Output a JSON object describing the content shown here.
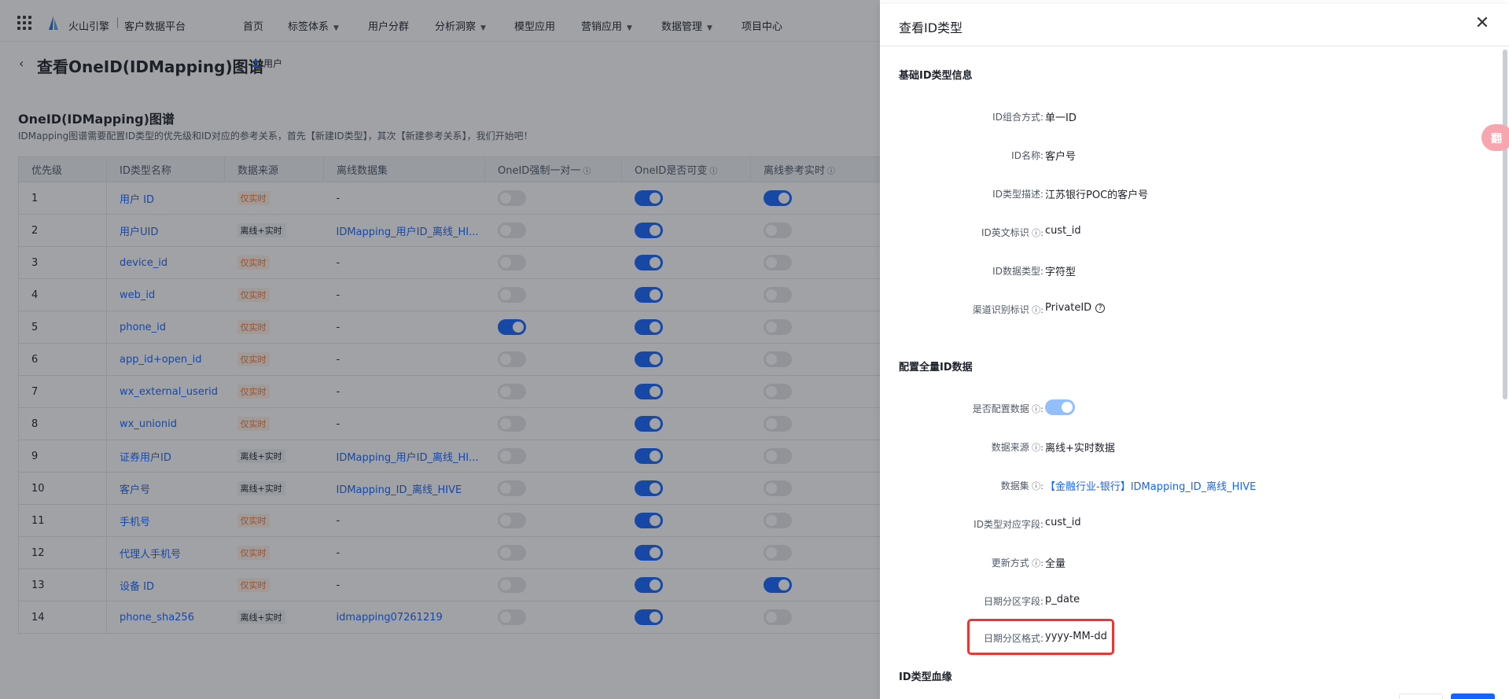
{
  "header": {
    "brand": "火山引擎",
    "platform": "客户数据平台",
    "nav": [
      {
        "label": "首页",
        "has_caret": false
      },
      {
        "label": "标签体系",
        "has_caret": true
      },
      {
        "label": "用户分群",
        "has_caret": false
      },
      {
        "label": "分析洞察",
        "has_caret": true
      },
      {
        "label": "模型应用",
        "has_caret": false
      },
      {
        "label": "营销应用",
        "has_caret": true
      },
      {
        "label": "数据管理",
        "has_caret": true
      },
      {
        "label": "项目中心",
        "has_caret": false
      }
    ]
  },
  "page": {
    "title": "查看OneID(IDMapping)图谱",
    "user_tag": "用户",
    "section_title": "OneID(IDMapping)图谱",
    "section_desc": "IDMapping图谱需要配置ID类型的优先级和ID对应的参考关系，首先【新建ID类型】，其次【新建参考关系】，我们开始吧！"
  },
  "table": {
    "headers": [
      "优先级",
      "ID类型名称",
      "数据来源",
      "离线数据集",
      "OneID强制一对一",
      "OneID是否可变",
      "离线参考实时"
    ],
    "rows": [
      {
        "priority": "1",
        "name": "用户 ID",
        "source": "仅实时",
        "source_type": "rt",
        "dataset": "-",
        "dataset_link": false,
        "forced": false,
        "mutable": true,
        "offline_ref": true
      },
      {
        "priority": "2",
        "name": "用户UID",
        "source": "离线+实时",
        "source_type": "mix",
        "dataset": "IDMapping_用户ID_离线_HI...",
        "dataset_link": true,
        "forced": false,
        "mutable": true,
        "offline_ref": false
      },
      {
        "priority": "3",
        "name": "device_id",
        "source": "仅实时",
        "source_type": "rt",
        "dataset": "-",
        "dataset_link": false,
        "forced": false,
        "mutable": true,
        "offline_ref": false
      },
      {
        "priority": "4",
        "name": "web_id",
        "source": "仅实时",
        "source_type": "rt",
        "dataset": "-",
        "dataset_link": false,
        "forced": false,
        "mutable": true,
        "offline_ref": false
      },
      {
        "priority": "5",
        "name": "phone_id",
        "source": "仅实时",
        "source_type": "rt",
        "dataset": "-",
        "dataset_link": false,
        "forced": true,
        "mutable": true,
        "offline_ref": false
      },
      {
        "priority": "6",
        "name": "app_id+open_id",
        "source": "仅实时",
        "source_type": "rt",
        "dataset": "-",
        "dataset_link": false,
        "forced": false,
        "mutable": true,
        "offline_ref": false
      },
      {
        "priority": "7",
        "name": "wx_external_userid",
        "source": "仅实时",
        "source_type": "rt",
        "dataset": "-",
        "dataset_link": false,
        "forced": false,
        "mutable": true,
        "offline_ref": false
      },
      {
        "priority": "8",
        "name": "wx_unionid",
        "source": "仅实时",
        "source_type": "rt",
        "dataset": "-",
        "dataset_link": false,
        "forced": false,
        "mutable": true,
        "offline_ref": false
      },
      {
        "priority": "9",
        "name": "证券用户ID",
        "source": "离线+实时",
        "source_type": "mix",
        "dataset": "IDMapping_用户ID_离线_HI...",
        "dataset_link": true,
        "forced": false,
        "mutable": true,
        "offline_ref": false
      },
      {
        "priority": "10",
        "name": "客户号",
        "source": "离线+实时",
        "source_type": "mix",
        "dataset": "IDMapping_ID_离线_HIVE",
        "dataset_link": true,
        "forced": false,
        "mutable": true,
        "offline_ref": false
      },
      {
        "priority": "11",
        "name": "手机号",
        "source": "仅实时",
        "source_type": "rt",
        "dataset": "-",
        "dataset_link": false,
        "forced": false,
        "mutable": true,
        "offline_ref": false
      },
      {
        "priority": "12",
        "name": "代理人手机号",
        "source": "仅实时",
        "source_type": "rt",
        "dataset": "-",
        "dataset_link": false,
        "forced": false,
        "mutable": true,
        "offline_ref": false
      },
      {
        "priority": "13",
        "name": "设备 ID",
        "source": "仅实时",
        "source_type": "rt",
        "dataset": "-",
        "dataset_link": false,
        "forced": false,
        "mutable": true,
        "offline_ref": true
      },
      {
        "priority": "14",
        "name": "phone_sha256",
        "source": "离线+实时",
        "source_type": "mix",
        "dataset": "idmapping07261219",
        "dataset_link": true,
        "forced": false,
        "mutable": true,
        "offline_ref": false
      }
    ]
  },
  "drawer": {
    "title": "查看ID类型",
    "section1": "基础ID类型信息",
    "basic": [
      {
        "label": "ID组合方式:",
        "value": "单一ID",
        "info": false
      },
      {
        "label": "ID名称:",
        "value": "客户号",
        "info": false
      },
      {
        "label": "ID类型描述:",
        "value": "江苏银行POC的客户号",
        "info": false
      },
      {
        "label": "ID英文标识",
        "value": "cust_id",
        "info": true
      },
      {
        "label": "ID数据类型:",
        "value": "字符型",
        "info": false
      },
      {
        "label": "渠道识别标识",
        "value": "PrivateID",
        "info": true
      }
    ],
    "section2": "配置全量ID数据",
    "full": [
      {
        "label": "是否配置数据",
        "value": "",
        "info": true
      },
      {
        "label": "数据来源",
        "value": "离线+实时数据",
        "info": true
      },
      {
        "label": "数据集",
        "value": "【金融行业-银行】IDMapping_ID_离线_HIVE",
        "info": true
      },
      {
        "label": "ID类型对应字段:",
        "value": "cust_id",
        "info": false
      },
      {
        "label": "更新方式",
        "value": "全量",
        "info": true
      },
      {
        "label": "日期分区字段:",
        "value": "p_date",
        "info": false
      },
      {
        "label": "日期分区格式:",
        "value": "yyyy-MM-dd",
        "info": false
      }
    ],
    "section3": "ID类型血缘",
    "config_toggle_on": true
  },
  "float_badge": "翻"
}
